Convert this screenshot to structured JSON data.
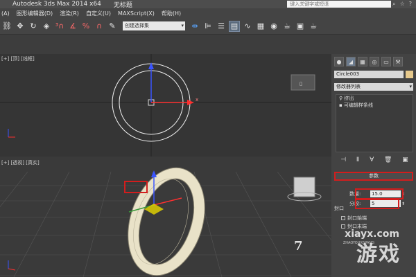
{
  "titlebar": {
    "app_title": "Autodesk 3ds Max  2014 x64",
    "doc_title": "无标题",
    "search_placeholder": "键入关键字或短语",
    "icons": [
      "binoculars-icon",
      "star-icon",
      "help-icon"
    ]
  },
  "menu": {
    "items": [
      "(A)",
      "图形编辑器(D)",
      "渲染(R)",
      "自定义(U)",
      "MAXScript(X)",
      "帮助(H)"
    ]
  },
  "toolbar": {
    "selection_set_placeholder": "创建选择集"
  },
  "viewports": {
    "top": {
      "label": "[+] [顶] [线框]"
    },
    "perspective": {
      "label": "[+] [透视] [真实]"
    }
  },
  "command_panel": {
    "object_name": "Circle003",
    "modifier_list": "修改器列表",
    "stack_items": [
      "挤出",
      "可编辑样条线"
    ],
    "parameters_title": "参数",
    "amount_label": "数量:",
    "amount_value": "15.0",
    "segments_label": "分段:",
    "segments_value": "5",
    "capping_title": "封口",
    "cap_start": "封口始端",
    "cap_end": "封口末端",
    "object_color": "#e6c98c",
    "highlight_color": "#d21d1d"
  },
  "watermark": {
    "number": "7",
    "site": "xiayx.com",
    "sub": "ZHAOYOUXIWANG",
    "brand": "游戏"
  }
}
